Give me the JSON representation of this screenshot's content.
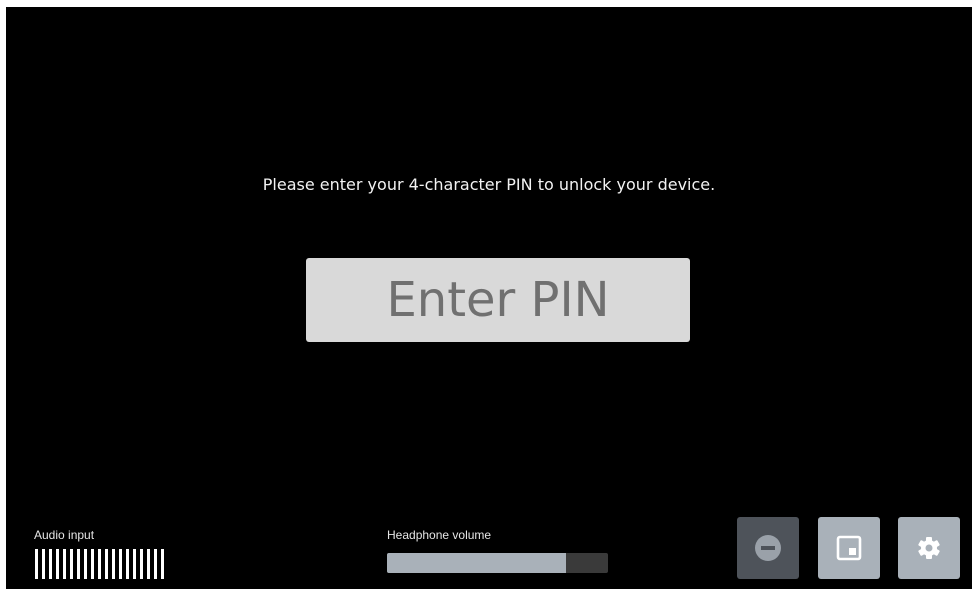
{
  "unlock": {
    "prompt": "Please enter your 4-character PIN to unlock your device.",
    "pin_placeholder": "Enter PIN",
    "pin_value": ""
  },
  "audio_input": {
    "label": "Audio input",
    "level_bars": 19
  },
  "headphone_volume": {
    "label": "Headphone volume",
    "level_percent": 81
  },
  "toolbar": {
    "buttons": [
      {
        "icon": "minus-circle-icon",
        "enabled": false
      },
      {
        "icon": "picture-in-picture-icon",
        "enabled": true
      },
      {
        "icon": "gear-icon",
        "enabled": true
      }
    ]
  },
  "colors": {
    "background": "#000000",
    "text": "#f2f2f2",
    "pin_field": "#d9d9d9",
    "pin_placeholder": "#707070",
    "button": "#a9b1b9",
    "button_disabled": "#4e535a",
    "volume_track": "#3a3a3a",
    "volume_fill": "#a9b1b9"
  }
}
